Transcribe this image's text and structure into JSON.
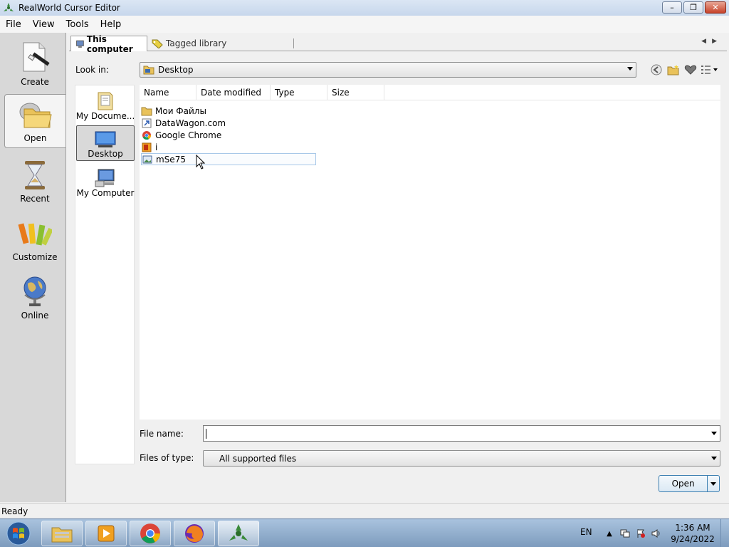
{
  "window": {
    "title": "RealWorld Cursor Editor",
    "controls": {
      "minimize": "–",
      "maximize": "❐",
      "close": "✕"
    }
  },
  "menu": {
    "items": [
      "File",
      "View",
      "Tools",
      "Help"
    ]
  },
  "nav": {
    "items": [
      {
        "label": "Create",
        "icon": "create-icon"
      },
      {
        "label": "Open",
        "icon": "folder-open-icon",
        "active": true
      },
      {
        "label": "Recent",
        "icon": "hourglass-icon"
      },
      {
        "label": "Customize",
        "icon": "pencils-icon"
      },
      {
        "label": "Online",
        "icon": "globe-icon"
      }
    ]
  },
  "tabs": {
    "this_computer": "This computer",
    "tagged_library": "Tagged library"
  },
  "lookin": {
    "label": "Look in:",
    "value": "Desktop"
  },
  "places": [
    {
      "label": "My Docume...",
      "icon": "documents-folder-icon"
    },
    {
      "label": "Desktop",
      "icon": "desktop-icon",
      "active": true
    },
    {
      "label": "My Computer",
      "icon": "computer-icon"
    }
  ],
  "columns": [
    "Name",
    "Date modified",
    "Type",
    "Size"
  ],
  "files": [
    {
      "name": "Мои Файлы",
      "icon": "folder-icon"
    },
    {
      "name": "DataWagon.com",
      "icon": "shortcut-icon"
    },
    {
      "name": "Google Chrome",
      "icon": "chrome-icon"
    },
    {
      "name": "i",
      "icon": "media-icon"
    },
    {
      "name": "mSe75",
      "icon": "image-icon",
      "selected": true
    }
  ],
  "filename": {
    "label": "File name:",
    "value": ""
  },
  "filetype": {
    "label": "Files of type:",
    "value": "All supported files"
  },
  "open_button": {
    "label": "Open"
  },
  "status": {
    "text": "Ready"
  },
  "tray": {
    "lang": "EN",
    "time": "1:36 AM",
    "date": "9/24/2022"
  },
  "colors": {
    "accent": "#3c7fb1",
    "taskbar": "#8fabca",
    "selection": "#a8c8e8"
  }
}
